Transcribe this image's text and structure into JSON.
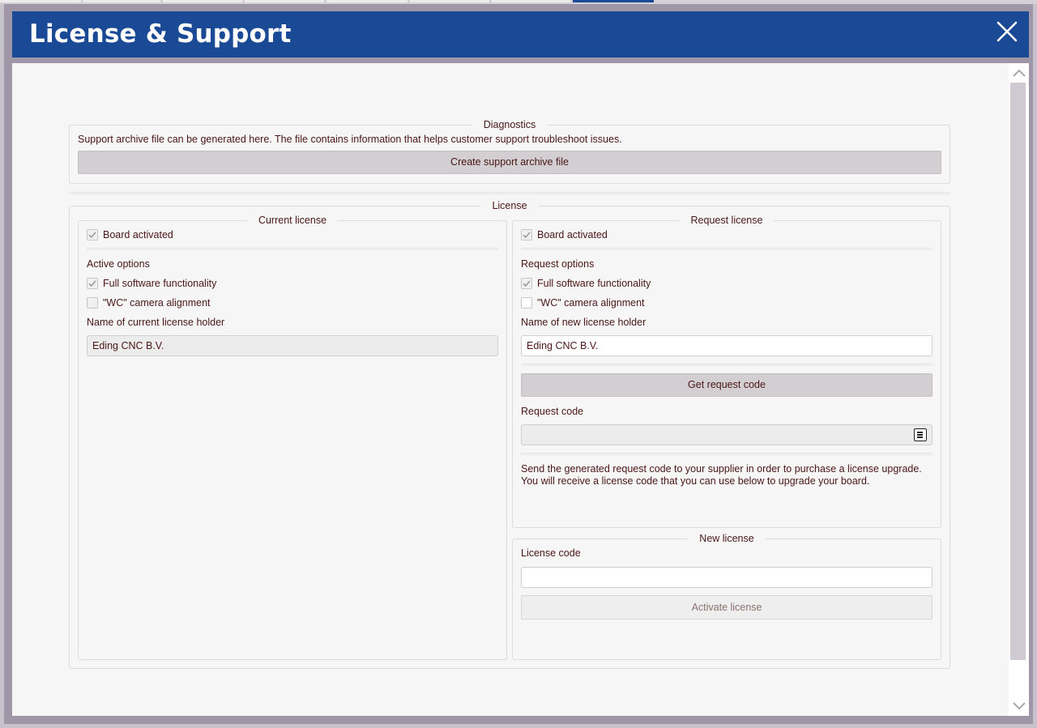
{
  "window": {
    "title": "License & Support"
  },
  "icons": {
    "close": "close-icon",
    "scroll_up": "chevron-up-icon",
    "scroll_down": "chevron-down-icon",
    "copy": "copy-clipboard-icon",
    "checkmark": "checkmark-icon"
  },
  "colors": {
    "titlebar": "#1a4a96",
    "frame": "#9f96a8",
    "text": "#4a1616",
    "button": "#d2ced2"
  },
  "diagnostics": {
    "legend": "Diagnostics",
    "description": "Support archive file can be generated here. The file contains information that helps customer support troubleshoot issues.",
    "button_label": "Create support archive file"
  },
  "license": {
    "legend": "License",
    "current": {
      "legend": "Current license",
      "board_activated_label": "Board activated",
      "board_activated": true,
      "options_heading": "Active options",
      "options": [
        {
          "label": "Full software functionality",
          "checked": true
        },
        {
          "label": "\"WC\" camera alignment",
          "checked": false
        }
      ],
      "holder_label": "Name of current license holder",
      "holder_value": "Eding CNC B.V."
    },
    "request": {
      "legend": "Request license",
      "board_activated_label": "Board activated",
      "board_activated": true,
      "options_heading": "Request options",
      "options": [
        {
          "label": "Full software functionality",
          "checked": true
        },
        {
          "label": "\"WC\" camera alignment",
          "checked": false
        }
      ],
      "holder_label": "Name of new license holder",
      "holder_value": "Eding CNC B.V.",
      "get_code_button": "Get request code",
      "request_code_label": "Request code",
      "request_code_value": "",
      "info_line1": "Send the generated request code to your supplier in order to purchase a license upgrade.",
      "info_line2": "You will receive a license code that you can use below to upgrade your board."
    },
    "new_license": {
      "legend": "New license",
      "code_label": "License code",
      "code_value": "",
      "activate_button": "Activate license"
    }
  }
}
